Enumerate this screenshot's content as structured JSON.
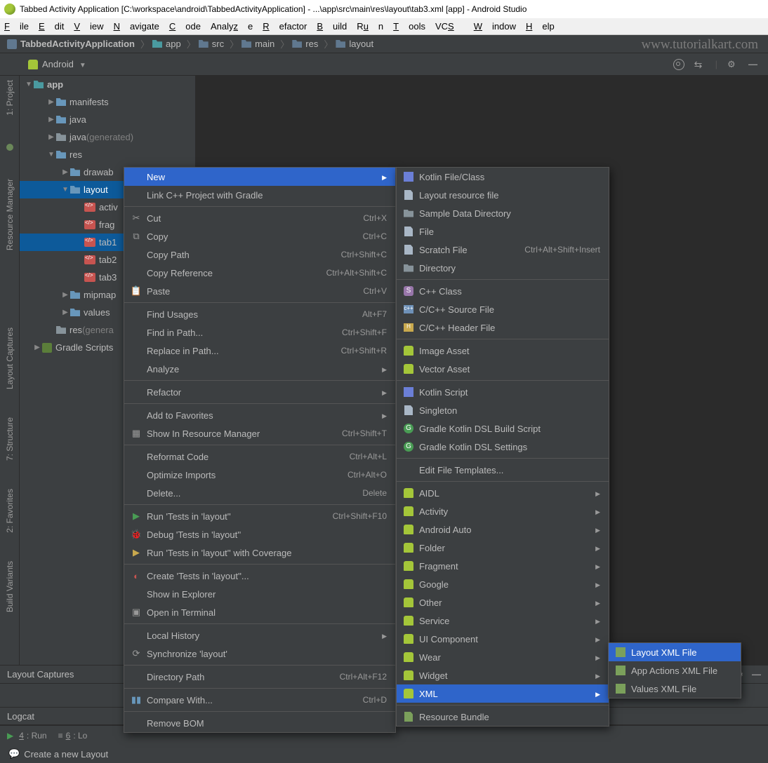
{
  "window": {
    "title": "Tabbed Activity Application [C:\\workspace\\android\\TabbedActivityApplication] - ...\\app\\src\\main\\res\\layout\\tab3.xml [app] - Android Studio"
  },
  "menubar": [
    "File",
    "Edit",
    "View",
    "Navigate",
    "Code",
    "Analyze",
    "Refactor",
    "Build",
    "Run",
    "Tools",
    "VCS",
    "Window",
    "Help"
  ],
  "breadcrumb": [
    "TabbedActivityApplication",
    "app",
    "src",
    "main",
    "res",
    "layout"
  ],
  "watermark": "www.tutorialkart.com",
  "toolbar": {
    "scope": "Android"
  },
  "leftTabs": [
    "1: Project",
    "Resource Manager",
    "Layout Captures",
    "7: Structure",
    "2: Favorites",
    "Build Variants"
  ],
  "tree": {
    "root": "app",
    "items": [
      {
        "label": "manifests",
        "depth": 1,
        "arrow": "right",
        "icon": "folder"
      },
      {
        "label": "java",
        "depth": 1,
        "arrow": "right",
        "icon": "folder"
      },
      {
        "label": "java",
        "suffix": "(generated)",
        "depth": 1,
        "arrow": "right",
        "icon": "folder-gear"
      },
      {
        "label": "res",
        "depth": 1,
        "arrow": "down",
        "icon": "folder"
      },
      {
        "label": "drawab",
        "depth": 2,
        "arrow": "right",
        "icon": "folder"
      },
      {
        "label": "layout",
        "depth": 2,
        "arrow": "down",
        "icon": "folder",
        "selected": true
      },
      {
        "label": "activ",
        "depth": 3,
        "icon": "xml"
      },
      {
        "label": "frag",
        "depth": 3,
        "icon": "xml"
      },
      {
        "label": "tab1",
        "depth": 3,
        "icon": "xml",
        "hl": true
      },
      {
        "label": "tab2",
        "depth": 3,
        "icon": "xml"
      },
      {
        "label": "tab3",
        "depth": 3,
        "icon": "xml"
      },
      {
        "label": "mipmap",
        "depth": 2,
        "arrow": "right",
        "icon": "folder"
      },
      {
        "label": "values",
        "depth": 2,
        "arrow": "right",
        "icon": "folder"
      },
      {
        "label": "res",
        "suffix": "(genera",
        "depth": 1,
        "icon": "folder-gear"
      },
      {
        "label": "Gradle Scripts",
        "depth": 0,
        "arrow": "right",
        "icon": "gradle"
      }
    ]
  },
  "ctx1": [
    {
      "type": "item",
      "label": "New",
      "submenu": true,
      "highlighted": true
    },
    {
      "type": "item",
      "label": "Link C++ Project with Gradle"
    },
    {
      "type": "sep"
    },
    {
      "type": "item",
      "label": "Cut",
      "shortcut": "Ctrl+X",
      "icon": "cut"
    },
    {
      "type": "item",
      "label": "Copy",
      "shortcut": "Ctrl+C",
      "icon": "copy"
    },
    {
      "type": "item",
      "label": "Copy Path",
      "shortcut": "Ctrl+Shift+C"
    },
    {
      "type": "item",
      "label": "Copy Reference",
      "shortcut": "Ctrl+Alt+Shift+C"
    },
    {
      "type": "item",
      "label": "Paste",
      "shortcut": "Ctrl+V",
      "icon": "paste"
    },
    {
      "type": "sep"
    },
    {
      "type": "item",
      "label": "Find Usages",
      "shortcut": "Alt+F7"
    },
    {
      "type": "item",
      "label": "Find in Path...",
      "shortcut": "Ctrl+Shift+F"
    },
    {
      "type": "item",
      "label": "Replace in Path...",
      "shortcut": "Ctrl+Shift+R"
    },
    {
      "type": "item",
      "label": "Analyze",
      "submenu": true
    },
    {
      "type": "sep"
    },
    {
      "type": "item",
      "label": "Refactor",
      "submenu": true
    },
    {
      "type": "sep"
    },
    {
      "type": "item",
      "label": "Add to Favorites",
      "submenu": true
    },
    {
      "type": "item",
      "label": "Show In Resource Manager",
      "shortcut": "Ctrl+Shift+T",
      "icon": "res"
    },
    {
      "type": "sep"
    },
    {
      "type": "item",
      "label": "Reformat Code",
      "shortcut": "Ctrl+Alt+L"
    },
    {
      "type": "item",
      "label": "Optimize Imports",
      "shortcut": "Ctrl+Alt+O"
    },
    {
      "type": "item",
      "label": "Delete...",
      "shortcut": "Delete"
    },
    {
      "type": "sep"
    },
    {
      "type": "item",
      "label": "Run 'Tests in 'layout''",
      "shortcut": "Ctrl+Shift+F10",
      "icon": "run"
    },
    {
      "type": "item",
      "label": "Debug 'Tests in 'layout''",
      "icon": "debug"
    },
    {
      "type": "item",
      "label": "Run 'Tests in 'layout'' with Coverage",
      "icon": "coverage"
    },
    {
      "type": "sep"
    },
    {
      "type": "item",
      "label": "Create 'Tests in 'layout''...",
      "icon": "rundebug"
    },
    {
      "type": "item",
      "label": "Show in Explorer"
    },
    {
      "type": "item",
      "label": "Open in Terminal",
      "icon": "terminal"
    },
    {
      "type": "sep"
    },
    {
      "type": "item",
      "label": "Local History",
      "submenu": true
    },
    {
      "type": "item",
      "label": "Synchronize 'layout'",
      "icon": "sync"
    },
    {
      "type": "sep"
    },
    {
      "type": "item",
      "label": "Directory Path",
      "shortcut": "Ctrl+Alt+F12"
    },
    {
      "type": "sep"
    },
    {
      "type": "item",
      "label": "Compare With...",
      "shortcut": "Ctrl+D",
      "icon": "diff"
    },
    {
      "type": "sep"
    },
    {
      "type": "item",
      "label": "Remove BOM"
    }
  ],
  "ctx2": [
    {
      "type": "item",
      "label": "Kotlin File/Class",
      "icon": "kotlin"
    },
    {
      "type": "item",
      "label": "Layout resource file",
      "icon": "file"
    },
    {
      "type": "item",
      "label": "Sample Data Directory",
      "icon": "folder"
    },
    {
      "type": "item",
      "label": "File",
      "icon": "file"
    },
    {
      "type": "item",
      "label": "Scratch File",
      "shortcut": "Ctrl+Alt+Shift+Insert",
      "icon": "file"
    },
    {
      "type": "item",
      "label": "Directory",
      "icon": "folder"
    },
    {
      "type": "sep"
    },
    {
      "type": "item",
      "label": "C++ Class",
      "icon": "s"
    },
    {
      "type": "item",
      "label": "C/C++ Source File",
      "icon": "cpp"
    },
    {
      "type": "item",
      "label": "C/C++ Header File",
      "icon": "h"
    },
    {
      "type": "sep"
    },
    {
      "type": "item",
      "label": "Image Asset",
      "icon": "android"
    },
    {
      "type": "item",
      "label": "Vector Asset",
      "icon": "android"
    },
    {
      "type": "sep"
    },
    {
      "type": "item",
      "label": "Kotlin Script",
      "icon": "kotlin"
    },
    {
      "type": "item",
      "label": "Singleton",
      "icon": "file"
    },
    {
      "type": "item",
      "label": "Gradle Kotlin DSL Build Script",
      "icon": "g"
    },
    {
      "type": "item",
      "label": "Gradle Kotlin DSL Settings",
      "icon": "g"
    },
    {
      "type": "sep"
    },
    {
      "type": "item",
      "label": "Edit File Templates..."
    },
    {
      "type": "sep"
    },
    {
      "type": "item",
      "label": "AIDL",
      "icon": "android",
      "submenu": true
    },
    {
      "type": "item",
      "label": "Activity",
      "icon": "android",
      "submenu": true
    },
    {
      "type": "item",
      "label": "Android Auto",
      "icon": "android",
      "submenu": true
    },
    {
      "type": "item",
      "label": "Folder",
      "icon": "android",
      "submenu": true
    },
    {
      "type": "item",
      "label": "Fragment",
      "icon": "android",
      "submenu": true
    },
    {
      "type": "item",
      "label": "Google",
      "icon": "android",
      "submenu": true
    },
    {
      "type": "item",
      "label": "Other",
      "icon": "android",
      "submenu": true
    },
    {
      "type": "item",
      "label": "Service",
      "icon": "android",
      "submenu": true
    },
    {
      "type": "item",
      "label": "UI Component",
      "icon": "android",
      "submenu": true
    },
    {
      "type": "item",
      "label": "Wear",
      "icon": "android",
      "submenu": true
    },
    {
      "type": "item",
      "label": "Widget",
      "icon": "android",
      "submenu": true
    },
    {
      "type": "item",
      "label": "XML",
      "icon": "android",
      "submenu": true,
      "highlighted": true
    },
    {
      "type": "sep"
    },
    {
      "type": "item",
      "label": "Resource Bundle",
      "icon": "bundle"
    }
  ],
  "ctx3": [
    {
      "type": "item",
      "label": "Layout XML File",
      "icon": "xml",
      "highlighted": true
    },
    {
      "type": "item",
      "label": "App Actions XML File",
      "icon": "xml"
    },
    {
      "type": "item",
      "label": "Values XML File",
      "icon": "xml"
    }
  ],
  "bottomTabs": {
    "layoutCaptures": "Layout Captures",
    "logcat": "Logcat",
    "run": "4: Run",
    "logcat2": "6: Lo"
  },
  "status": "Create a new Layout"
}
